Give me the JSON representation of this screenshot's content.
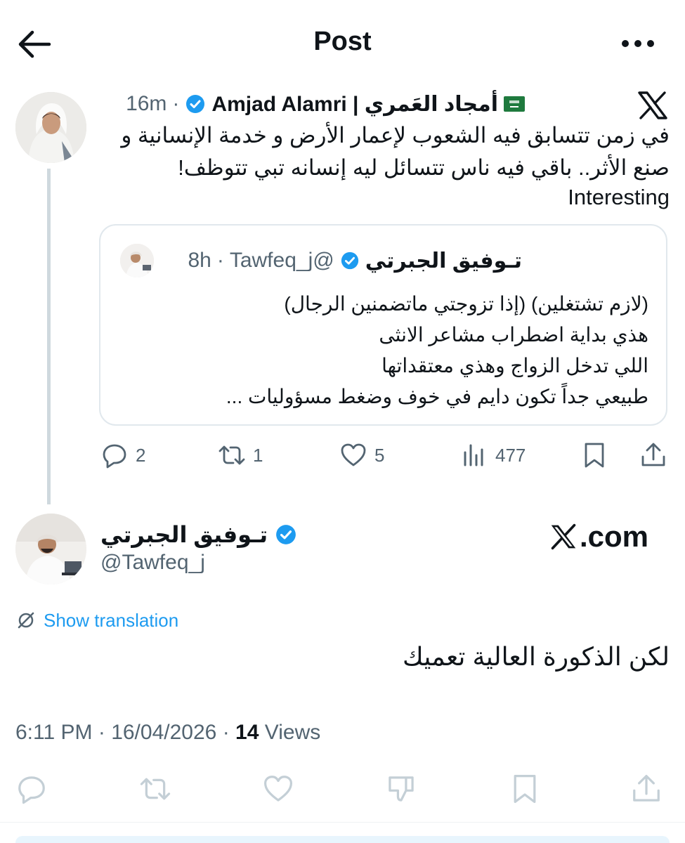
{
  "header": {
    "title": "Post",
    "back_icon": "arrow-left-icon",
    "more_icon": "more-horizontal-icon"
  },
  "parent_tweet": {
    "author_name": "أمجاد العَمري | Amjad Alamri",
    "flag_icon": "saudi-flag-icon",
    "verified_icon": "verified-badge-icon",
    "separator": "·",
    "time": "16m",
    "platform_icon": "x-logo-icon",
    "text_lines": [
      "في زمن تتسابق فيه الشعوب لإعمار الأرض و خدمة الإنسانية و",
      "صنع الأثر.. باقي فيه ناس تتسائل ليه إنسانه تبي تتوظف!",
      "Interesting"
    ],
    "quote": {
      "author_name": "تـوفيق الجبرتي",
      "handle": "@Tawfeq_j",
      "separator": "·",
      "time": "8h",
      "text_lines": [
        "(لازم تشتغلين) (إذا تزوجتي ماتضمنين الرجال)",
        "هذي بداية اضطراب مشاعر الانثى",
        "اللي تدخل الزواج وهذي معتقداتها",
        "طبيعي جداً تكون دايم في خوف وضغط مسؤوليات ..."
      ]
    },
    "actions": {
      "replies": "2",
      "reposts": "1",
      "likes": "5",
      "views": "477"
    }
  },
  "main_tweet": {
    "author_name": "تـوفيق الجبرتي",
    "handle": "@Tawfeq_j",
    "watermark": ".com",
    "translation_label": "Show translation",
    "text": "لكن الذكورة العالية تعميك",
    "time": "6:11 PM",
    "date": "16/04/2026",
    "separator": "·",
    "views_count": "14",
    "views_label": "Views"
  },
  "colors": {
    "accent": "#1d9bf0",
    "text": "#0f1419",
    "muted": "#536471",
    "border": "#e1e8ed",
    "action_disabled": "#c4cfd6"
  }
}
